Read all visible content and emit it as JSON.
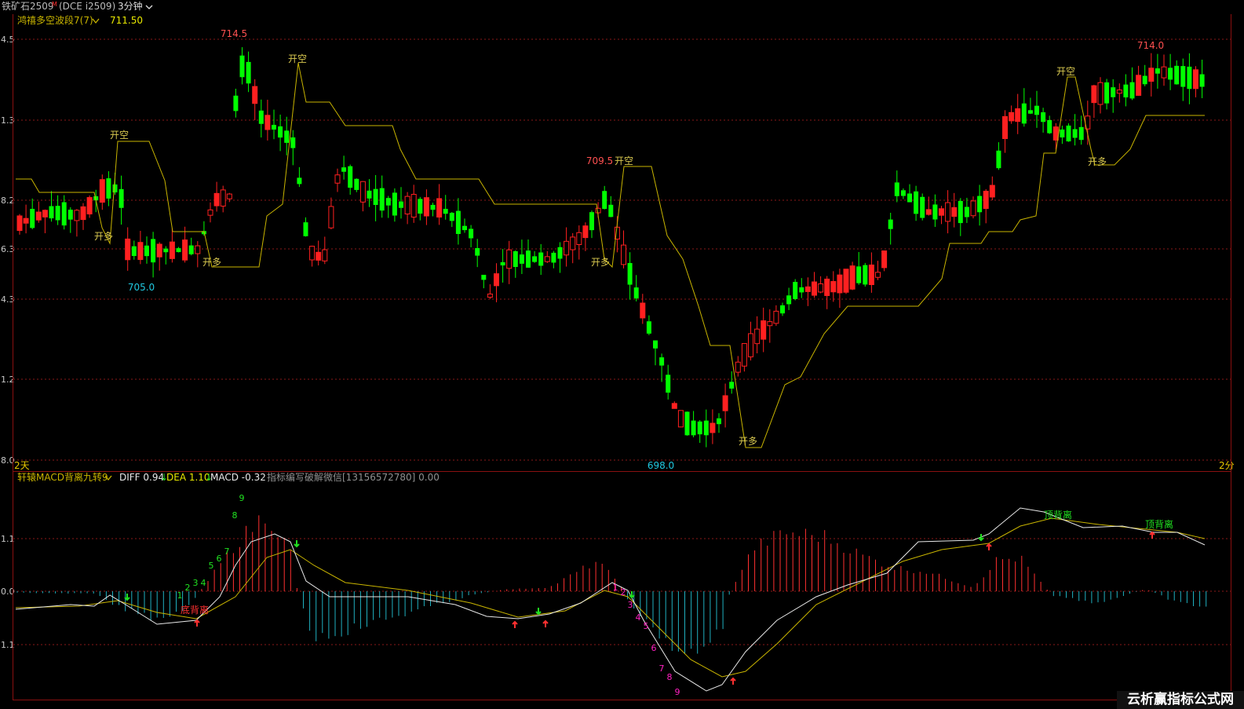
{
  "header": {
    "instrument": "铁矿石2509",
    "instrument_mark": "M",
    "code": "(DCE i2509)",
    "period": "3分钟",
    "period_icon": "chevron-down-icon"
  },
  "main_panel": {
    "indicator_name": "鸿禧多空波段7(7)",
    "indicator_value": "711.50",
    "y_ticks": [
      "4.5",
      "1.3",
      "8.2",
      "6.3",
      "4.3",
      "1.2",
      "8.0"
    ],
    "bottom_left_label": "2天",
    "bottom_right_label": "2分",
    "price_labels": {
      "high1": "714.5",
      "high2": "709.5",
      "high3": "714.0",
      "low1": "705.0",
      "low2": "698.0"
    },
    "signals": {
      "open_short": "开空",
      "open_long": "开多"
    },
    "colors": {
      "up": "#ff2020",
      "down": "#00ff00",
      "band": "#c8b400",
      "grid": "#8a1818"
    }
  },
  "sub_panel": {
    "indicator_name": "轩辕MACD背离九转9",
    "diff_label": "DIFF",
    "diff_value": "0.94",
    "dea_label": "DEA",
    "dea_value": "1.10",
    "macd_label": "MACD",
    "macd_value": "-0.32",
    "note": "指标编写破解微信[13156572780] 0.00",
    "y_ticks": [
      "1.1",
      "0.0",
      "1.1"
    ],
    "divergence_bottom": "底背离",
    "divergence_top": "顶背离",
    "nine_turn_up": [
      "1",
      "2",
      "3",
      "4",
      "5",
      "6",
      "7",
      "8",
      "9"
    ],
    "nine_turn_down": [
      "1",
      "2",
      "3",
      "4",
      "5",
      "6",
      "7",
      "8",
      "9"
    ],
    "colors": {
      "diff": "#e8e8e8",
      "dea": "#c8b400",
      "macd_pos": "#ff3030",
      "macd_neg": "#20b0c0"
    }
  },
  "watermark": "云析赢指标公式网"
}
